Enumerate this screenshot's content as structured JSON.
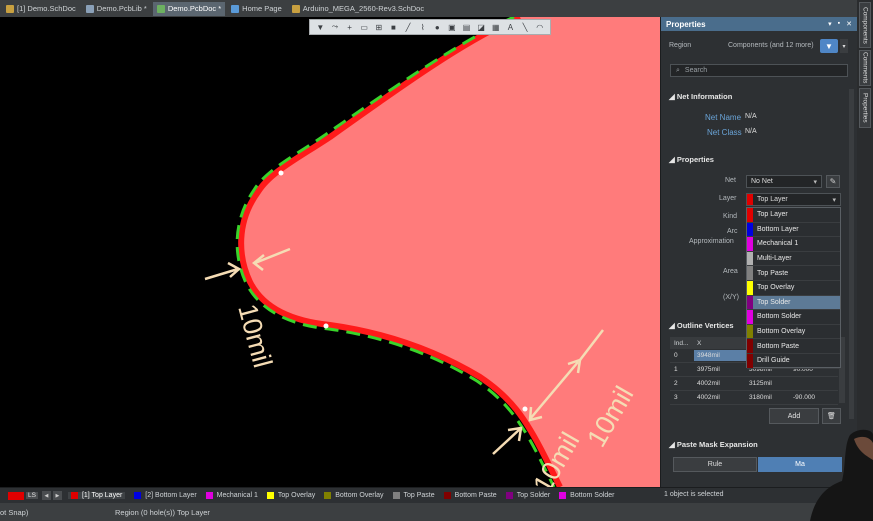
{
  "tabs": [
    {
      "label": "[1] Demo.SchDoc",
      "color": "#c8a040",
      "active": false
    },
    {
      "label": "Demo.PcbLib *",
      "color": "#8aa0b8",
      "active": false
    },
    {
      "label": "Demo.PcbDoc *",
      "color": "#6cb060",
      "active": true
    },
    {
      "label": "Home Page",
      "color": "#5a9ad8",
      "active": false
    },
    {
      "label": "Arduino_MEGA_2560-Rev3.SchDoc",
      "color": "#c8a040",
      "active": false
    }
  ],
  "canvas": {
    "annotations": [
      "10mil",
      "10mil",
      "10mil"
    ],
    "colors": {
      "region_fill": "#ff7b7b",
      "region_edge": "#ff1a1a",
      "dashed_edge": "#39d42a",
      "dimension": "#f5dcb4"
    }
  },
  "properties": {
    "title": "Properties",
    "object_type": "Region",
    "filter_value": "Components (and 12 more)",
    "search_placeholder": "Search",
    "net_info": {
      "section": "Net Information",
      "net_name_label": "Net Name",
      "net_name_value": "N/A",
      "net_class_label": "Net Class",
      "net_class_value": "N/A"
    },
    "props": {
      "section": "Properties",
      "net_label": "Net",
      "net_value": "No Net",
      "layer_label": "Layer",
      "layer_value": "Top Layer",
      "kind_label": "Kind",
      "arc_label": "Arc",
      "approx_label": "Approximation",
      "area_label": "Area",
      "xy_label": "(X/Y)"
    },
    "layer_options": [
      {
        "label": "Top Layer",
        "color": "#e00000"
      },
      {
        "label": "Bottom Layer",
        "color": "#0000e0"
      },
      {
        "label": "Mechanical 1",
        "color": "#e000e0"
      },
      {
        "label": "Multi-Layer",
        "color": "#b0b0b0"
      },
      {
        "label": "Top Paste",
        "color": "#808080"
      },
      {
        "label": "Top Overlay",
        "color": "#ffff00"
      },
      {
        "label": "Top Solder",
        "color": "#800080",
        "selected": true
      },
      {
        "label": "Bottom Solder",
        "color": "#e000e0"
      },
      {
        "label": "Bottom Overlay",
        "color": "#808000"
      },
      {
        "label": "Bottom Paste",
        "color": "#800000"
      },
      {
        "label": "Drill Guide",
        "color": "#800000"
      }
    ],
    "outline": {
      "section": "Outline Vertices",
      "headers": [
        "Ind...",
        "X",
        "",
        ""
      ],
      "rows": [
        {
          "index": "0",
          "x": "3948mil",
          "y": "",
          "angle": ""
        },
        {
          "index": "1",
          "x": "3975mil",
          "y": "3098mil",
          "angle": "90.000"
        },
        {
          "index": "2",
          "x": "4002mil",
          "y": "3125mil",
          "angle": ""
        },
        {
          "index": "3",
          "x": "4002mil",
          "y": "3180mil",
          "angle": "-90.000"
        }
      ],
      "add_label": "Add"
    },
    "paste_mask": {
      "section": "Paste Mask Expansion",
      "rule_label": "Rule",
      "manual_label": "Ma"
    }
  },
  "side_tabs": [
    "Components",
    "Comments",
    "Properties"
  ],
  "layer_bar": {
    "ls_label": "LS",
    "items": [
      {
        "label": "[1] Top Layer",
        "color": "#e00000",
        "active": true
      },
      {
        "label": "[2] Bottom Layer",
        "color": "#0000e0"
      },
      {
        "label": "Mechanical 1",
        "color": "#e000e0"
      },
      {
        "label": "Top Overlay",
        "color": "#ffff00"
      },
      {
        "label": "Bottom Overlay",
        "color": "#808000"
      },
      {
        "label": "Top Paste",
        "color": "#808080"
      },
      {
        "label": "Bottom Paste",
        "color": "#800000"
      },
      {
        "label": "Top Solder",
        "color": "#800080"
      },
      {
        "label": "Bottom Solder",
        "color": "#e000e0"
      }
    ],
    "selection": "1 object is selected"
  },
  "status": {
    "snap": "ot Snap)",
    "info": "Region (0 hole(s)) Top Layer"
  }
}
